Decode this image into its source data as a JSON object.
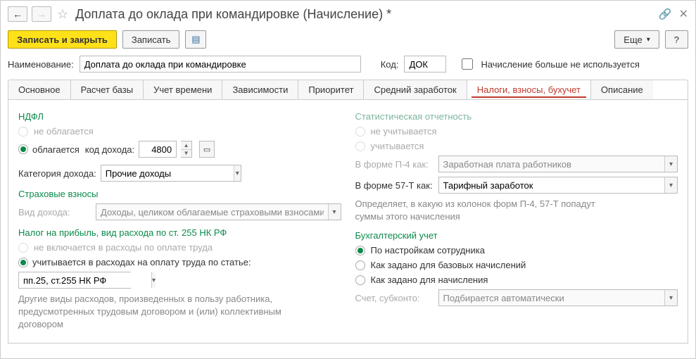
{
  "title": "Доплата до оклада при командировке (Начисление) *",
  "toolbar": {
    "save_close": "Записать и закрыть",
    "save": "Записать",
    "more": "Еще",
    "help": "?"
  },
  "header": {
    "name_label": "Наименование:",
    "name_value": "Доплата до оклада при командировке",
    "code_label": "Код:",
    "code_value": "ДОК",
    "unused_label": "Начисление больше не используется"
  },
  "tabs": [
    "Основное",
    "Расчет базы",
    "Учет времени",
    "Зависимости",
    "Приоритет",
    "Средний заработок",
    "Налоги, взносы, бухучет",
    "Описание"
  ],
  "active_tab": 6,
  "left": {
    "ndfl_title": "НДФЛ",
    "ndfl_not": "не облагается",
    "ndfl_yes_prefix": "облагается",
    "ndfl_income_code_label": "код дохода:",
    "ndfl_income_code": "4800",
    "category_label": "Категория дохода:",
    "category_value": "Прочие доходы",
    "ins_title": "Страховые взносы",
    "ins_kind_label": "Вид дохода:",
    "ins_kind_value": "Доходы, целиком облагаемые страховыми взносами",
    "profit_title": "Налог на прибыль, вид расхода по ст. 255 НК РФ",
    "profit_not": "не включается в расходы по оплате труда",
    "profit_yes": "учитывается в расходах на оплату труда по статье:",
    "profit_article": "пп.25, ст.255 НК РФ",
    "profit_hint": "Другие виды расходов, произведенных в пользу работника, предусмотренных трудовым договором и (или) коллективным договором"
  },
  "right": {
    "stat_title": "Статистическая отчетность",
    "stat_not": "не учитывается",
    "stat_yes": "учитывается",
    "p4_label": "В форме П-4 как:",
    "p4_value": "Заработная плата работников",
    "t57_label": "В форме 57-Т как:",
    "t57_value": "Тарифный заработок",
    "stat_hint": "Определяет, в какую из колонок форм П-4, 57-Т попадут суммы этого начисления",
    "acc_title": "Бухгалтерский учет",
    "acc_opt1": "По настройкам сотрудника",
    "acc_opt2": "Как задано для базовых начислений",
    "acc_opt3": "Как задано для начисления",
    "acc_sub_label": "Счет, субконто:",
    "acc_sub_value": "Подбирается автоматически"
  }
}
